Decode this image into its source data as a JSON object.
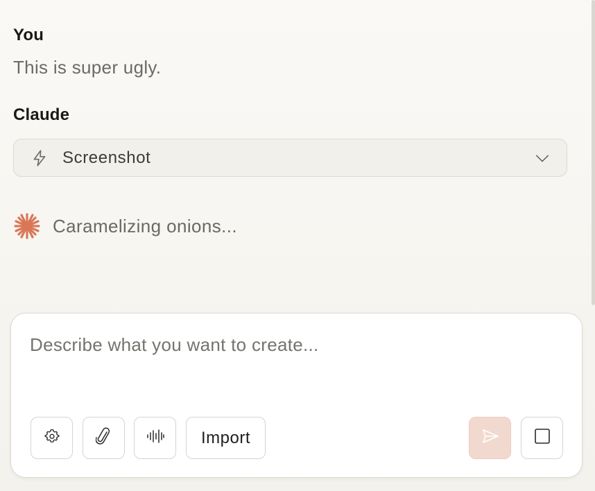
{
  "conversation": {
    "user_speaker": "You",
    "user_message": "This is super ugly.",
    "assistant_speaker": "Claude",
    "tool": {
      "icon": "bolt-icon",
      "label": "Screenshot",
      "chevron": "chevron-down-icon"
    },
    "status": {
      "icon": "claude-spark-icon",
      "text": "Caramelizing onions..."
    }
  },
  "composer": {
    "placeholder": "Describe what you want to create...",
    "buttons": {
      "settings_icon": "gear-icon",
      "attach_icon": "paperclip-icon",
      "voice_icon": "waveform-icon",
      "import_label": "Import",
      "send_icon": "send-icon",
      "stop_icon": "stop-square-icon"
    }
  },
  "colors": {
    "accent": "#d97757",
    "send_bg": "#f2d9cf",
    "background": "#f7f6f2"
  }
}
